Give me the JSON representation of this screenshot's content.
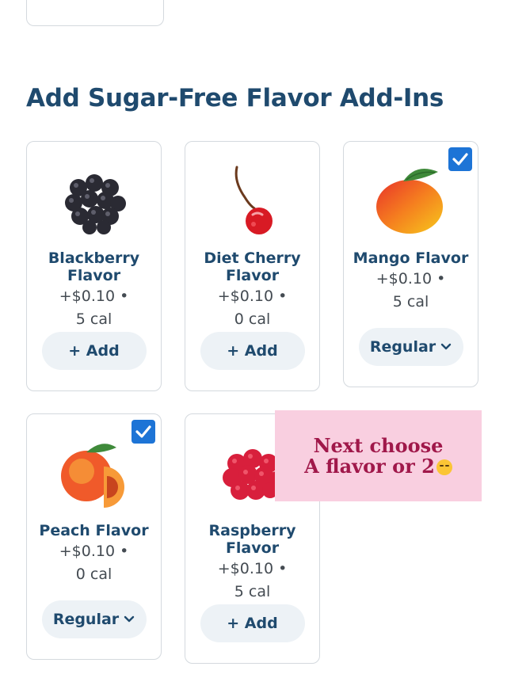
{
  "section": {
    "title": "Add Sugar-Free Flavor Add-Ins"
  },
  "flavors": [
    {
      "name": "Blackberry Flavor",
      "price": "+$0.10 •",
      "cal": "5 cal",
      "button": "+ Add",
      "selected": false
    },
    {
      "name": "Diet Cherry Flavor",
      "price": "+$0.10 •",
      "cal": "0 cal",
      "button": "+ Add",
      "selected": false
    },
    {
      "name": "Mango Flavor",
      "price": "+$0.10 •",
      "cal": "5 cal",
      "button": "Regular",
      "selected": true
    },
    {
      "name": "Peach Flavor",
      "price": "+$0.10 •",
      "cal": "0 cal",
      "button": "Regular",
      "selected": true
    },
    {
      "name": "Raspberry Flavor",
      "price": "+$0.10 •",
      "cal": "5 cal",
      "button": "+ Add",
      "selected": false
    }
  ],
  "overlay": {
    "line1": "Next choose",
    "line2": "A flavor or 2"
  },
  "colors": {
    "title": "#1f4a6e",
    "check": "#1d74d6",
    "overlay_bg": "#f9cfe0",
    "overlay_text": "#a0184a",
    "button_bg": "#edf2f6"
  }
}
